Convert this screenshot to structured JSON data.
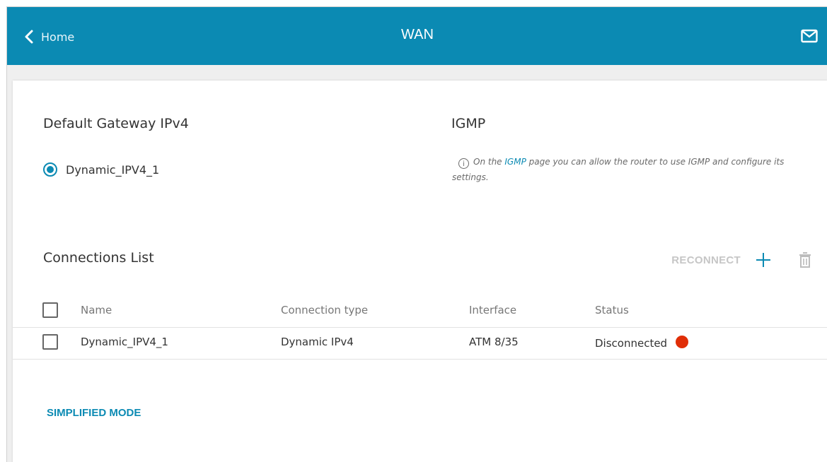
{
  "header": {
    "back_label": "Home",
    "title": "WAN",
    "mail_icon": "mail-icon",
    "back_icon": "chevron-left-icon"
  },
  "gateway": {
    "title": "Default Gateway IPv4",
    "selected_option": "Dynamic_IPV4_1"
  },
  "igmp": {
    "title": "IGMP",
    "info_prefix": "On the",
    "info_link": "IGMP",
    "info_suffix": "page you can allow the router to use IGMP and configure its settings.",
    "info_icon": "info-icon"
  },
  "connections": {
    "title": "Connections List",
    "reconnect_label": "RECONNECT",
    "add_icon": "plus-icon",
    "delete_icon": "trash-icon",
    "columns": {
      "name": "Name",
      "type": "Connection type",
      "interface": "Interface",
      "status": "Status"
    },
    "rows": [
      {
        "name": "Dynamic_IPV4_1",
        "type": "Dynamic IPv4",
        "interface": "ATM 8/35",
        "status": "Disconnected",
        "status_color": "#e02e07"
      }
    ]
  },
  "footer": {
    "simplified_mode_label": "SIMPLIFIED MODE"
  },
  "colors": {
    "accent": "#0b8ab3",
    "background": "#efefef",
    "disconnected": "#e02e07"
  }
}
